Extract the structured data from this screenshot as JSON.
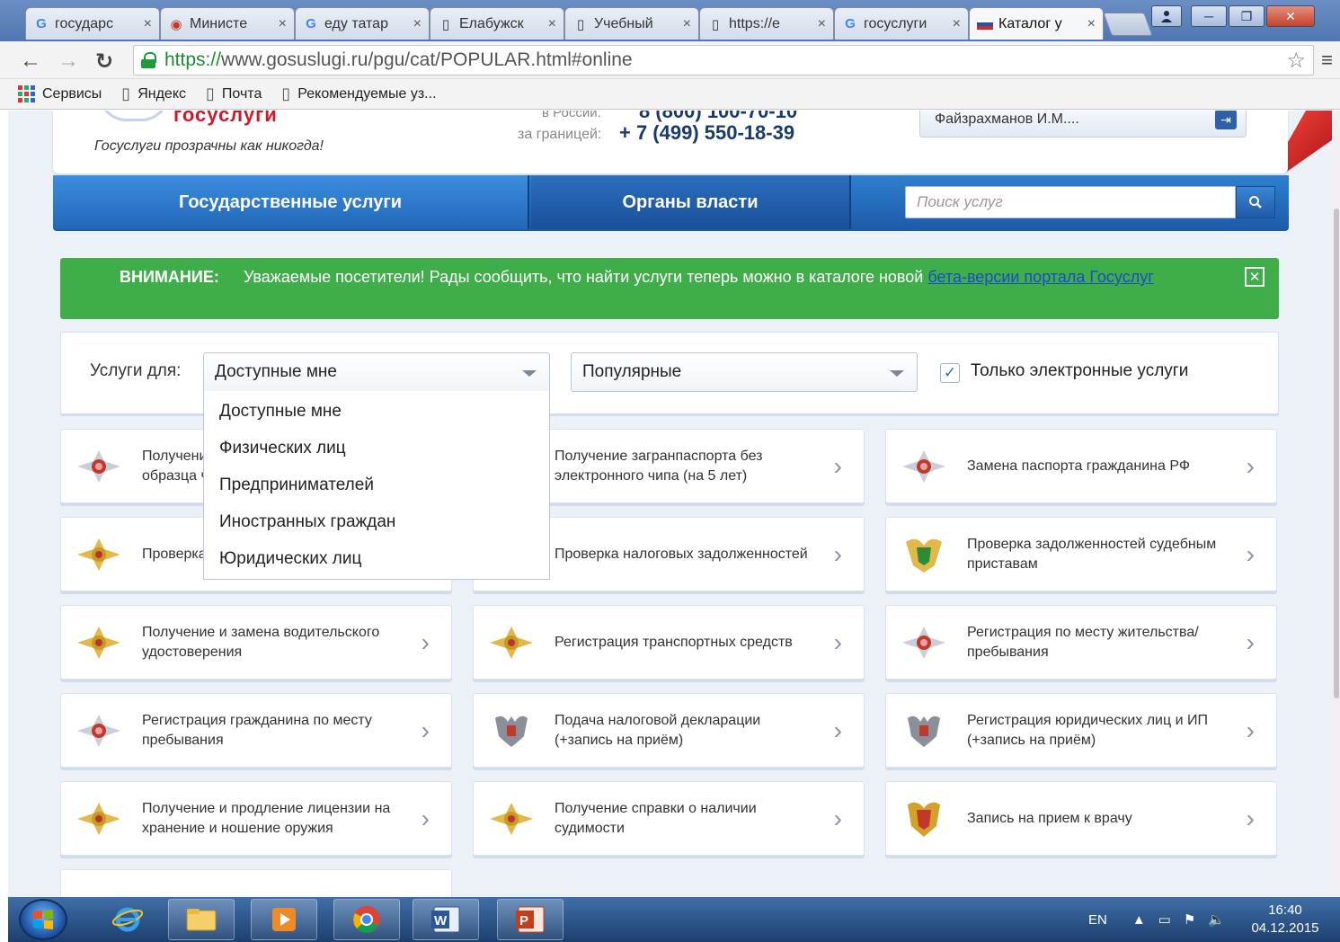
{
  "browser": {
    "tabs": [
      {
        "label": "государс",
        "icon": "google-icon"
      },
      {
        "label": "Министе",
        "icon": "ministry-icon"
      },
      {
        "label": "еду татар",
        "icon": "google-icon"
      },
      {
        "label": "Елабужск",
        "icon": "page-icon"
      },
      {
        "label": "Учебный",
        "icon": "page-icon"
      },
      {
        "label": "https://e",
        "icon": "page-icon"
      },
      {
        "label": "госуслуги",
        "icon": "google-icon"
      },
      {
        "label": "Каталог у",
        "icon": "flag-icon",
        "active": true
      }
    ],
    "url_secure": "https://",
    "url_rest": "www.gosuslugi.ru/pgu/cat/POPULAR.html#online",
    "bookmarks": [
      {
        "label": "Сервисы",
        "icon": "apps-icon"
      },
      {
        "label": "Яндекс",
        "icon": "page-icon"
      },
      {
        "label": "Почта",
        "icon": "page-icon"
      },
      {
        "label": "Рекомендуемые уз...",
        "icon": "page-icon"
      }
    ]
  },
  "header": {
    "logo_text": "госуслуги",
    "tagline": "Госуслуги прозрачны как никогда!",
    "phone_label_top": "в России:",
    "phone_top": "8 (800) 100-70-10",
    "phone_label": "за границей:",
    "phone": "+ 7 (499) 550-18-39",
    "user_name": "Файзрахманов И.М...."
  },
  "nav": {
    "item1": "Государственные услуги",
    "item2": "Органы власти",
    "search_placeholder": "Поиск услуг"
  },
  "alert": {
    "title": "ВНИМАНИЕ:",
    "text": "Уважаемые посетители! Рады сообщить, что найти услуги теперь можно в каталоге новой ",
    "link": "бета-версии портала Госуслуг",
    "close_symbol": "✕"
  },
  "filter": {
    "label": "Услуги для:",
    "select1_value": "Доступные мне",
    "select2_value": "Популярные",
    "checkbox_checked": true,
    "checkbox_label": "Только электронные услуги",
    "options": [
      "Доступные мне",
      "Физических лиц",
      "Предпринимателей",
      "Иностранных граждан",
      "Юридических лиц"
    ]
  },
  "services": [
    {
      "text": "Получение загранпаспорта нового образца через электронный",
      "visible": "Получен электрон",
      "emblem": "mvd-red"
    },
    {
      "text": "Получение загранпаспорта без электронного чипа (на 5 лет)",
      "emblem": "none"
    },
    {
      "text": "Замена паспорта гражданина РФ",
      "emblem": "mvd-red"
    },
    {
      "text": "Проверка штрафов ГИБДД",
      "visible": "Провер ГИБДД",
      "emblem": "mvd-gold"
    },
    {
      "text": "Проверка налоговых задолженностей",
      "emblem": "none"
    },
    {
      "text": "Проверка задолженностей судебным приставам",
      "emblem": "fssp"
    },
    {
      "text": "Получение и замена водительского удостоверения",
      "emblem": "mvd-gold"
    },
    {
      "text": "Регистрация транспортных средств",
      "emblem": "mvd-gold"
    },
    {
      "text": "Регистрация по месту жительства/пребывания",
      "emblem": "mvd-red"
    },
    {
      "text": "Регистрация гражданина по месту пребывания",
      "emblem": "mvd-red"
    },
    {
      "text": "Подача налоговой декларации (+запись на приём)",
      "emblem": "eagle"
    },
    {
      "text": "Регистрация юридических лиц и ИП (+запись на приём)",
      "emblem": "eagle"
    },
    {
      "text": "Получение и продление лицензии на хранение и ношение оружия",
      "emblem": "mvd-gold"
    },
    {
      "text": "Получение справки о наличии судимости",
      "emblem": "mvd-gold"
    },
    {
      "text": "Запись на прием к врачу",
      "emblem": "health"
    }
  ],
  "taskbar": {
    "lang": "EN",
    "time": "16:40",
    "date": "04.12.2015"
  },
  "colors": {
    "nav_blue": "#2366b8",
    "alert_green": "#3fae4a",
    "logo_red": "#d0182a",
    "link_blue": "#1a4cc7"
  }
}
